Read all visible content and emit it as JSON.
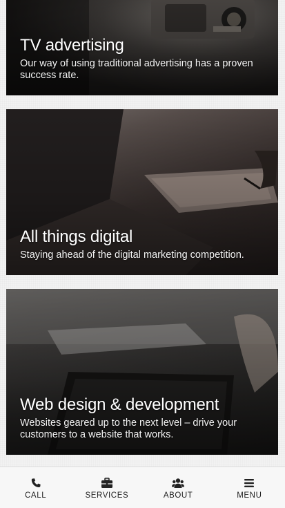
{
  "cards": [
    {
      "title": "TV advertising",
      "description": "Our way of using traditional advertising has a proven success rate."
    },
    {
      "title": "All things digital",
      "description": "Staying ahead of the digital marketing competition."
    },
    {
      "title": "Web design & development",
      "description": "Websites geared up to the next level – drive your customers to a website that works."
    }
  ],
  "bottom_nav": {
    "items": [
      {
        "label": "CALL",
        "icon": "phone-icon"
      },
      {
        "label": "SERVICES",
        "icon": "briefcase-icon"
      },
      {
        "label": "ABOUT",
        "icon": "users-icon"
      },
      {
        "label": "MENU",
        "icon": "hamburger-icon"
      }
    ]
  }
}
